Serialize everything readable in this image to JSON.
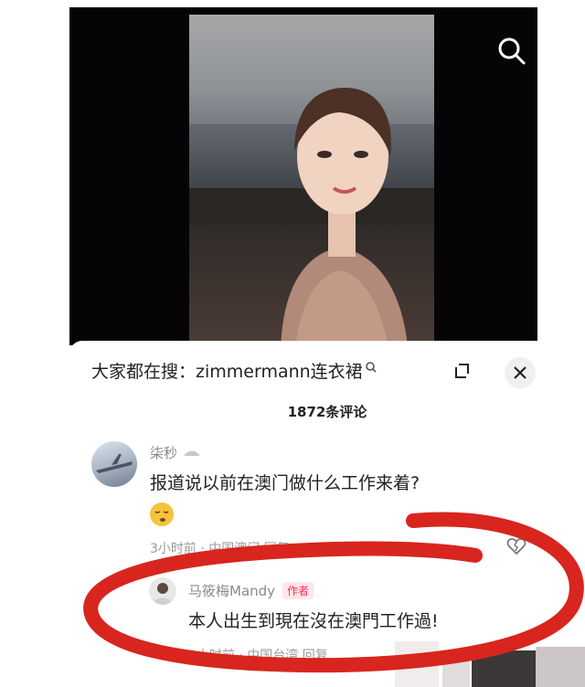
{
  "hot_search": {
    "prefix": "大家都在搜：",
    "keyword": "zimmermann连衣裙"
  },
  "comment_count": "1872条评论",
  "comments": [
    {
      "user": "柒秒",
      "text": "报道说以前在澳门做什么工作来着?",
      "meta": "3小时前 · 中国澳门   回复"
    },
    {
      "user": "马筱梅Mandy",
      "badge": "作者",
      "text": "本人出生到現在沒在澳門工作過!",
      "meta": "1小时前 · 中国台湾   回复"
    }
  ],
  "colors": {
    "annotation_circle": "#d8251e",
    "author_badge": "#fe2c55"
  },
  "icons": [
    "search-icon",
    "expand-icon",
    "close-icon",
    "heart-broken-icon",
    "search-small-icon"
  ]
}
